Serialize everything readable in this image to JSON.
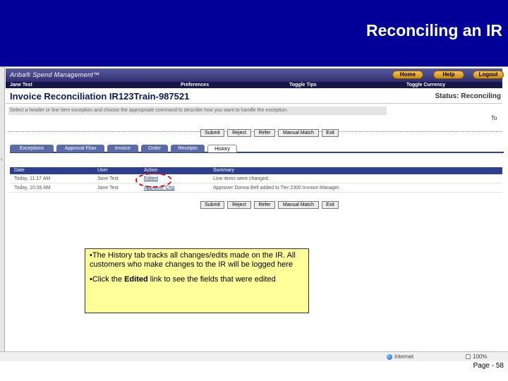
{
  "slide": {
    "title": "Reconciling an IR",
    "page_number": "Page - 58"
  },
  "app": {
    "logo": "Ariba® Spend Management™",
    "header_buttons": {
      "home": "Home",
      "help": "Help",
      "logout": "Logout"
    },
    "user_bar": {
      "user": "Jane Test",
      "preferences": "Preferences",
      "toggle_tips": "Toggle Tips",
      "toggle_currency": "Toggle Currency"
    },
    "page_title": "Invoice Reconciliation IR123Train-987521",
    "status": "Status: Reconciling",
    "instructions": "Select a header or line item exception and choose the appropriate command to describe how you want to handle the exception.",
    "to_fragment": "To",
    "action_buttons": {
      "submit": "Submit",
      "reject": "Reject",
      "refer": "Refer",
      "manual_match": "Manual Match",
      "exit": "Exit"
    },
    "tabs": [
      {
        "label": "Exceptions",
        "active": false
      },
      {
        "label": "Approval Flow",
        "active": false
      },
      {
        "label": "Invoice",
        "active": false
      },
      {
        "label": "Order",
        "active": false
      },
      {
        "label": "Receipts",
        "active": false
      },
      {
        "label": "History",
        "active": true
      }
    ],
    "history_table": {
      "columns": [
        "Date",
        "User",
        "Action",
        "Summary"
      ],
      "rows": [
        {
          "date": "Today, 11:17 AM",
          "user": "Jane Test",
          "action": "Edited",
          "summary": "Line items were changed."
        },
        {
          "date": "Today, 10:35 AM",
          "user": "Jane Test",
          "action": "Approver Chg",
          "summary": "Approver Donna Bell added to Tier 2300 Invoice Manager."
        }
      ]
    }
  },
  "callout": {
    "bullet1": "•The History tab tracks all changes/edits made on the IR.  All customers who make changes to the IR will be logged here",
    "bullet2_prefix": "•Click the ",
    "bullet2_bold": "Edited",
    "bullet2_suffix": " link to see the fields that were edited"
  },
  "statusbar": {
    "zone": "Internet",
    "zoom": "100%"
  },
  "colors": {
    "banner": "#000099",
    "app_header": "#2e2e70",
    "tab_bar": "#2f3f8f",
    "callout": "#ffff99",
    "highlight": "#d41010",
    "header_button": "#e5a42e"
  },
  "icons": [
    "globe-icon",
    "zoom-icon",
    "grip-icon"
  ]
}
